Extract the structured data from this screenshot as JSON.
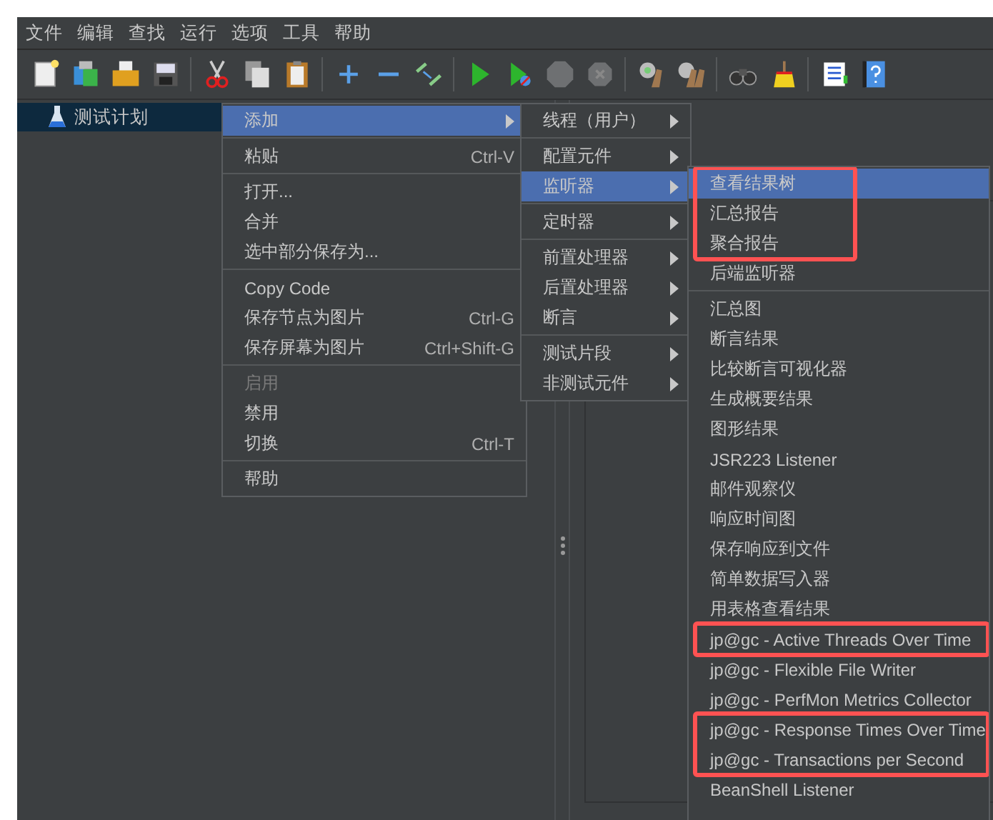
{
  "menubar": [
    {
      "label": "文件"
    },
    {
      "label": "编辑"
    },
    {
      "label": "查找"
    },
    {
      "label": "运行"
    },
    {
      "label": "选项"
    },
    {
      "label": "工具"
    },
    {
      "label": "帮助"
    }
  ],
  "toolbar": [
    {
      "kind": "new"
    },
    {
      "kind": "templates"
    },
    {
      "kind": "open"
    },
    {
      "kind": "save"
    },
    {
      "kind": "separator"
    },
    {
      "kind": "cut"
    },
    {
      "kind": "copy"
    },
    {
      "kind": "paste"
    },
    {
      "kind": "separator"
    },
    {
      "kind": "expand"
    },
    {
      "kind": "collapse"
    },
    {
      "kind": "toggle"
    },
    {
      "kind": "separator"
    },
    {
      "kind": "start"
    },
    {
      "kind": "start_no_pause"
    },
    {
      "kind": "stop"
    },
    {
      "kind": "shutdown"
    },
    {
      "kind": "separator"
    },
    {
      "kind": "clear"
    },
    {
      "kind": "clear_all"
    },
    {
      "kind": "separator"
    },
    {
      "kind": "search"
    },
    {
      "kind": "reset_search"
    },
    {
      "kind": "separator"
    },
    {
      "kind": "function_helper"
    },
    {
      "kind": "help"
    }
  ],
  "tree": [
    {
      "label": "测试计划",
      "selected": true
    }
  ],
  "context_menu": [
    {
      "kind": "item",
      "label": "添加",
      "submenu": true,
      "selected": true,
      "disabled": false
    },
    {
      "kind": "separator"
    },
    {
      "kind": "item",
      "label": "粘贴",
      "shortcut": "Ctrl-V",
      "submenu": false,
      "selected": false,
      "disabled": false
    },
    {
      "kind": "separator"
    },
    {
      "kind": "item",
      "label": "打开...",
      "submenu": false,
      "selected": false,
      "disabled": false
    },
    {
      "kind": "item",
      "label": "合并",
      "submenu": false,
      "selected": false,
      "disabled": false
    },
    {
      "kind": "item",
      "label": "选中部分保存为...",
      "submenu": false,
      "selected": false,
      "disabled": false
    },
    {
      "kind": "separator"
    },
    {
      "kind": "item",
      "label": "Copy Code",
      "submenu": false,
      "selected": false,
      "disabled": false
    },
    {
      "kind": "item",
      "label": "保存节点为图片",
      "shortcut": "Ctrl-G",
      "submenu": false,
      "selected": false,
      "disabled": false
    },
    {
      "kind": "item",
      "label": "保存屏幕为图片",
      "shortcut": "Ctrl+Shift-G",
      "submenu": false,
      "selected": false,
      "disabled": false
    },
    {
      "kind": "separator"
    },
    {
      "kind": "item",
      "label": "启用",
      "submenu": false,
      "selected": false,
      "disabled": true
    },
    {
      "kind": "item",
      "label": "禁用",
      "submenu": false,
      "selected": false,
      "disabled": false
    },
    {
      "kind": "item",
      "label": "切换",
      "shortcut": "Ctrl-T",
      "submenu": false,
      "selected": false,
      "disabled": false
    },
    {
      "kind": "separator"
    },
    {
      "kind": "item",
      "label": "帮助",
      "submenu": false,
      "selected": false,
      "disabled": false
    }
  ],
  "add_submenu": [
    {
      "kind": "item",
      "label": "线程（用户）",
      "submenu": true,
      "selected": false
    },
    {
      "kind": "separator"
    },
    {
      "kind": "item",
      "label": "配置元件",
      "submenu": true,
      "selected": false
    },
    {
      "kind": "item",
      "label": "监听器",
      "submenu": true,
      "selected": true
    },
    {
      "kind": "separator"
    },
    {
      "kind": "item",
      "label": "定时器",
      "submenu": true,
      "selected": false
    },
    {
      "kind": "separator"
    },
    {
      "kind": "item",
      "label": "前置处理器",
      "submenu": true,
      "selected": false
    },
    {
      "kind": "item",
      "label": "后置处理器",
      "submenu": true,
      "selected": false
    },
    {
      "kind": "item",
      "label": "断言",
      "submenu": true,
      "selected": false
    },
    {
      "kind": "separator"
    },
    {
      "kind": "item",
      "label": "测试片段",
      "submenu": true,
      "selected": false
    },
    {
      "kind": "item",
      "label": "非测试元件",
      "submenu": true,
      "selected": false
    }
  ],
  "listener_submenu": [
    {
      "kind": "item",
      "label": "查看结果树",
      "selected": true,
      "boxed": true
    },
    {
      "kind": "item",
      "label": "汇总报告",
      "selected": false,
      "boxed": true
    },
    {
      "kind": "item",
      "label": "聚合报告",
      "selected": false,
      "boxed": true
    },
    {
      "kind": "item",
      "label": "后端监听器",
      "selected": false,
      "boxed": false
    },
    {
      "kind": "separator"
    },
    {
      "kind": "item",
      "label": "汇总图",
      "selected": false,
      "boxed": false
    },
    {
      "kind": "item",
      "label": "断言结果",
      "selected": false,
      "boxed": false
    },
    {
      "kind": "item",
      "label": "比较断言可视化器",
      "selected": false,
      "boxed": false
    },
    {
      "kind": "item",
      "label": "生成概要结果",
      "selected": false,
      "boxed": false
    },
    {
      "kind": "item",
      "label": "图形结果",
      "selected": false,
      "boxed": false
    },
    {
      "kind": "item",
      "label": "JSR223 Listener",
      "selected": false,
      "boxed": false
    },
    {
      "kind": "item",
      "label": "邮件观察仪",
      "selected": false,
      "boxed": false
    },
    {
      "kind": "item",
      "label": "响应时间图",
      "selected": false,
      "boxed": false
    },
    {
      "kind": "item",
      "label": "保存响应到文件",
      "selected": false,
      "boxed": false
    },
    {
      "kind": "item",
      "label": "简单数据写入器",
      "selected": false,
      "boxed": false
    },
    {
      "kind": "item",
      "label": "用表格查看结果",
      "selected": false,
      "boxed": false
    },
    {
      "kind": "item",
      "label": "jp@gc - Active Threads Over Time",
      "selected": false,
      "boxed": true
    },
    {
      "kind": "item",
      "label": "jp@gc - Flexible File Writer",
      "selected": false,
      "boxed": false
    },
    {
      "kind": "item",
      "label": "jp@gc - PerfMon Metrics Collector",
      "selected": false,
      "boxed": false
    },
    {
      "kind": "item",
      "label": "jp@gc - Response Times Over Time",
      "selected": false,
      "boxed": true
    },
    {
      "kind": "item",
      "label": "jp@gc - Transactions per Second",
      "selected": false,
      "boxed": true
    },
    {
      "kind": "item",
      "label": "BeanShell Listener",
      "selected": false,
      "boxed": false
    }
  ]
}
